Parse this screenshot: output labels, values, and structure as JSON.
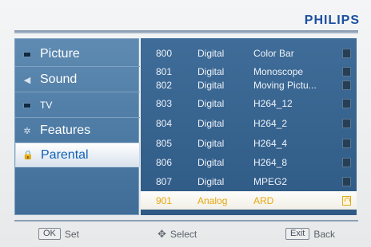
{
  "brand": "PHILIPS",
  "menu": [
    {
      "label": "Picture",
      "icon": "picture-icon"
    },
    {
      "label": "Sound",
      "icon": "speaker-icon"
    },
    {
      "label": "TV",
      "icon": "tv-icon"
    },
    {
      "label": "Features",
      "icon": "gear-icon"
    },
    {
      "label": "Parental",
      "icon": "lock-icon",
      "selected": true
    }
  ],
  "channels": [
    {
      "num": "800",
      "type": "Digital",
      "name": "Color Bar",
      "locked": false
    },
    {
      "num": "801",
      "type": "Digital",
      "name": "Monoscope",
      "locked": false
    },
    {
      "num": "802",
      "type": "Digital",
      "name": "Moving Pictu...",
      "locked": false
    },
    {
      "num": "803",
      "type": "Digital",
      "name": "H264_12",
      "locked": false
    },
    {
      "num": "804",
      "type": "Digital",
      "name": "H264_2",
      "locked": false
    },
    {
      "num": "805",
      "type": "Digital",
      "name": "H264_4",
      "locked": false
    },
    {
      "num": "806",
      "type": "Digital",
      "name": "H264_8",
      "locked": false
    },
    {
      "num": "807",
      "type": "Digital",
      "name": "MPEG2",
      "locked": false
    },
    {
      "num": "901",
      "type": "Analog",
      "name": "ARD",
      "locked": true,
      "selected": true
    }
  ],
  "footer": {
    "ok_key": "OK",
    "ok_label": "Set",
    "select_label": "Select",
    "exit_key": "Exit",
    "exit_label": "Back"
  },
  "colors": {
    "brand": "#1b4f9f",
    "highlight_text": "#e7a70f",
    "menu_bg": "#4f7ca6"
  }
}
